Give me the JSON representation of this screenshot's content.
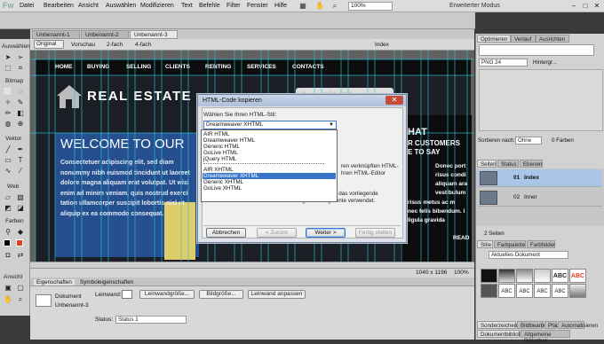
{
  "app": {
    "logo": "Fw"
  },
  "menubar": {
    "items": [
      "Datei",
      "Bearbeiten",
      "Ansicht",
      "Auswählen",
      "Modifizieren",
      "Text",
      "Befehle",
      "Filter",
      "Fenster",
      "Hilfe"
    ],
    "zoom": "100%",
    "workspace": "Erweiterter Modus"
  },
  "doc_tabs": [
    "Unbenannt-1",
    "Unbenannt-2",
    "Unbenannt-3"
  ],
  "view_bar": {
    "original": "Original",
    "preview": "Vorschau",
    "two_up": "2-fach",
    "four_up": "4-fach",
    "page": "Index"
  },
  "tools": {
    "select": "Auswählen",
    "bitmap": "Bitmap",
    "vector": "Vektor",
    "web": "Web",
    "colors": "Farben",
    "view": "Ansicht"
  },
  "site": {
    "nav": [
      "HOME",
      "BUYING",
      "SELLING",
      "CLIENTS",
      "RENTING",
      "SERVICES",
      "CONTACTS"
    ],
    "brand": "REAL ESTATE",
    "headline": "WELCOME TO OUR",
    "body": "Consectetuer adipiscing elit, sed diam nonummy nibh euismod tincidunt ut laoreet dolore magna aliquam erat volutpat. Ut wisi enim ad minim veniam, quis nostrud exerci tation ullamcorper suscipit lobortis nisl ut aliquip ex ea commodo consequat.",
    "price": "Preis: 150.000",
    "r1": "HAT",
    "r2": "R CUSTOMERS",
    "r3": "E TO SAY",
    "r4": "Donec port",
    "r5": "risus condi",
    "r6": "aliquam ara",
    "r7": "vestibulum",
    "r8": "risus metus ac m",
    "r9": "nec felis bibendum. l",
    "r10": "ligula gravida",
    "r11": "READ"
  },
  "status": {
    "size": "1040 x 1196",
    "zoom": "100%"
  },
  "props": {
    "tabs": [
      "Eigenschaften",
      "Symboleigenschaften"
    ],
    "doc_label": "Dokument",
    "doc_name": "Unbenannt-3",
    "canvas_label": "Leinwand:",
    "btn_canvas_size": "Leinwandgröße...",
    "btn_image_size": "Bildgröße...",
    "btn_fit": "Leinwand anpassen",
    "status_label": "Status:",
    "status_value": "Status 1"
  },
  "right_panel": {
    "tabs": [
      "Optimieren",
      "Verlauf",
      "Ausrichten"
    ],
    "format": "PNG 24",
    "matte": "Hintergr...",
    "sort_label": "Sortieren nach:",
    "sort_value": "Ohne",
    "colors": "0 Farben",
    "pages_tabs": [
      "Seiten",
      "Status",
      "Ebenen"
    ],
    "pages": [
      {
        "num": "01",
        "name": "Index"
      },
      {
        "num": "02",
        "name": "Inner"
      }
    ],
    "pages_count": "2 Seiten",
    "styles_tabs": [
      "Stile",
      "Farbpalette",
      "Farbfelder"
    ],
    "styles_select": "Aktuelles Dokument",
    "bottom_tabs": [
      "Sonderzeichen",
      "Bildbearbeiten",
      "Pfad",
      "Automatisieren"
    ],
    "lib_tabs": [
      "Dokumentbibliothek",
      "Allgemeine Bibliothek"
    ]
  },
  "dialog": {
    "title": "HTML-Code kopieren",
    "label": "Wählen Sie Ihren HTML-Stil:",
    "selected": "Dreamweaver XHTML",
    "options_group1": [
      "AIR HTML",
      "Dreamweaver HTML",
      "Generic HTML",
      "GoLive HTML",
      "jQuery HTML"
    ],
    "options_group2": [
      "AIR XHTML",
      "Dreamweaver XHTML",
      "Generic XHTML",
      "GoLive XHTML"
    ],
    "highlighted": "Dreamweaver XHTML",
    "side_line1": "ren verknüpften HTML-",
    "side_line2": "hren HTML-Editor",
    "description": "Es werden die derzeit gültigen Exporteinstellungen für das vorliegende Dokument einschließlich aller Einstellungen für Segmente verwendet.",
    "btn_cancel": "Abbrechen",
    "btn_back": "< Zurück",
    "btn_next": "Weiter >",
    "btn_finish": "Fertig stellen"
  }
}
